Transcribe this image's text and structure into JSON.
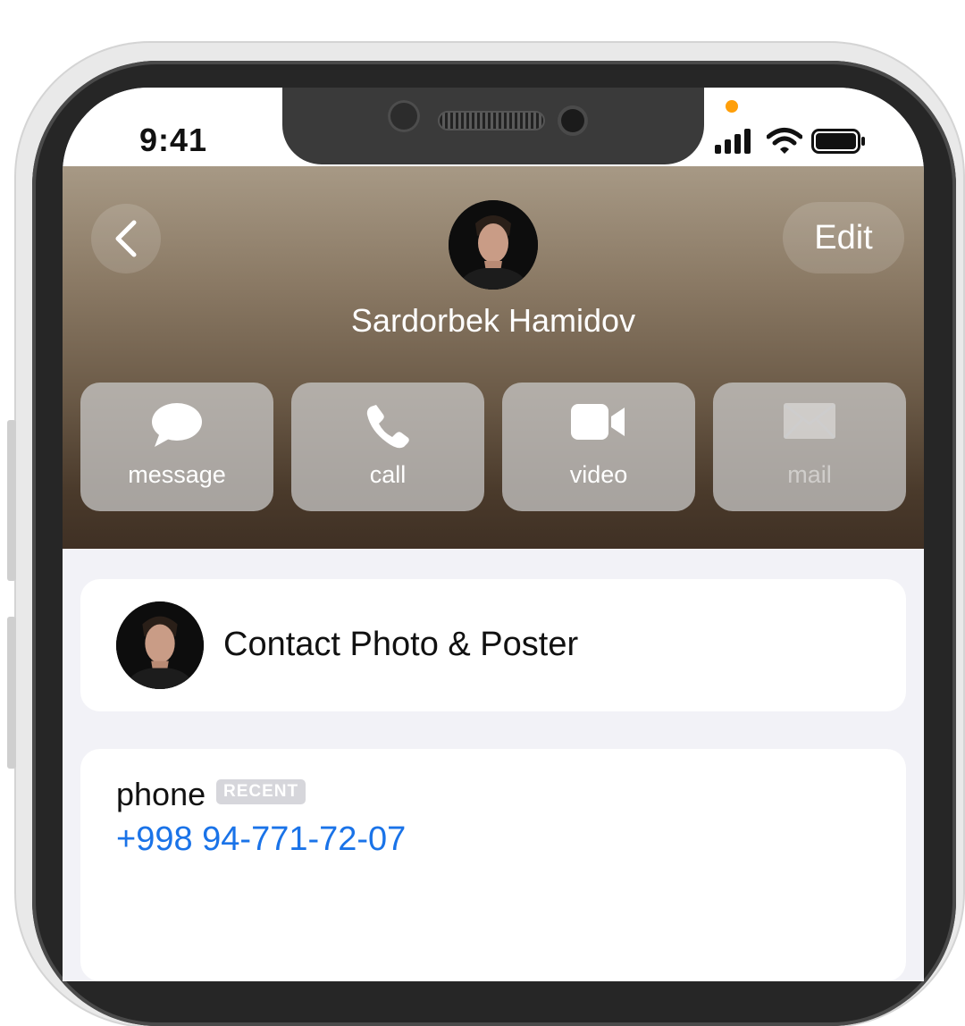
{
  "status_bar": {
    "time": "9:41"
  },
  "header": {
    "back_icon": "chevron-left-icon",
    "edit_label": "Edit",
    "contact_name": "Sardorbek Hamidov"
  },
  "actions": [
    {
      "label": "message",
      "icon": "message-bubble-icon",
      "enabled": true
    },
    {
      "label": "call",
      "icon": "phone-icon",
      "enabled": true
    },
    {
      "label": "video",
      "icon": "video-camera-icon",
      "enabled": true
    },
    {
      "label": "mail",
      "icon": "envelope-icon",
      "enabled": false
    }
  ],
  "contact_photo_card": {
    "label": "Contact Photo & Poster"
  },
  "phone_card": {
    "label": "phone",
    "badge": "RECENT",
    "number": "+998 94-771-72-07"
  },
  "colors": {
    "header_top": "#a79985",
    "header_bottom": "#3f3024",
    "link_blue": "#1a73e8",
    "mic_indicator": "#ff9f0a"
  }
}
